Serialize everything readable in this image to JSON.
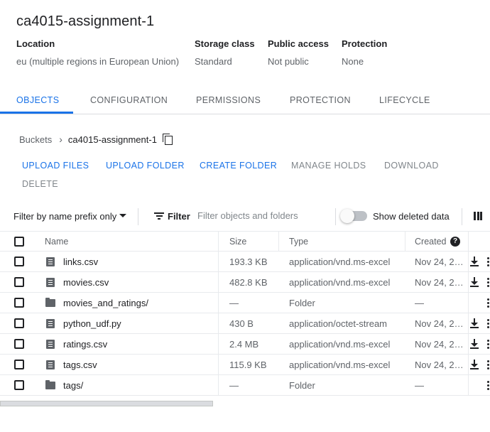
{
  "bucket": {
    "title": "ca4015-assignment-1",
    "location_label": "Location",
    "location_value": "eu (multiple regions in European Union)",
    "storage_label": "Storage class",
    "storage_value": "Standard",
    "access_label": "Public access",
    "access_value": "Not public",
    "protection_label": "Protection",
    "protection_value": "None"
  },
  "tabs": [
    {
      "label": "OBJECTS",
      "active": true
    },
    {
      "label": "CONFIGURATION"
    },
    {
      "label": "PERMISSIONS"
    },
    {
      "label": "PROTECTION"
    },
    {
      "label": "LIFECYCLE"
    }
  ],
  "breadcrumb": {
    "root": "Buckets",
    "separator": "›",
    "current": "ca4015-assignment-1"
  },
  "actions": {
    "upload_files": "UPLOAD FILES",
    "upload_folder": "UPLOAD FOLDER",
    "create_folder": "CREATE FOLDER",
    "manage_holds": "MANAGE HOLDS",
    "download": "DOWNLOAD",
    "delete": "DELETE"
  },
  "toolbar": {
    "prefix_select": "Filter by name prefix only",
    "filter_label": "Filter",
    "filter_placeholder": "Filter objects and folders",
    "show_deleted_label": "Show deleted data",
    "show_deleted_on": false
  },
  "table": {
    "columns": {
      "name": "Name",
      "size": "Size",
      "type": "Type",
      "created": "Created"
    },
    "rows": [
      {
        "name": "links.csv",
        "size": "193.3 KB",
        "type": "application/vnd.ms-excel",
        "created": "Nov 24, 2…",
        "kind": "file-icon"
      },
      {
        "name": "movies.csv",
        "size": "482.8 KB",
        "type": "application/vnd.ms-excel",
        "created": "Nov 24, 2…",
        "kind": "file-icon"
      },
      {
        "name": "movies_and_ratings/",
        "size": "—",
        "type": "Folder",
        "created": "—",
        "kind": "folder-icon"
      },
      {
        "name": "python_udf.py",
        "size": "430 B",
        "type": "application/octet-stream",
        "created": "Nov 24, 2…",
        "kind": "file-icon"
      },
      {
        "name": "ratings.csv",
        "size": "2.4 MB",
        "type": "application/vnd.ms-excel",
        "created": "Nov 24, 2…",
        "kind": "file-icon"
      },
      {
        "name": "tags.csv",
        "size": "115.9 KB",
        "type": "application/vnd.ms-excel",
        "created": "Nov 24, 2…",
        "kind": "file-icon"
      },
      {
        "name": "tags/",
        "size": "—",
        "type": "Folder",
        "created": "—",
        "kind": "folder-icon"
      }
    ]
  },
  "colors": {
    "accent": "#1a73e8",
    "muted_text": "#5f6368",
    "disabled_text": "#80868b",
    "border": "#dadce0"
  }
}
